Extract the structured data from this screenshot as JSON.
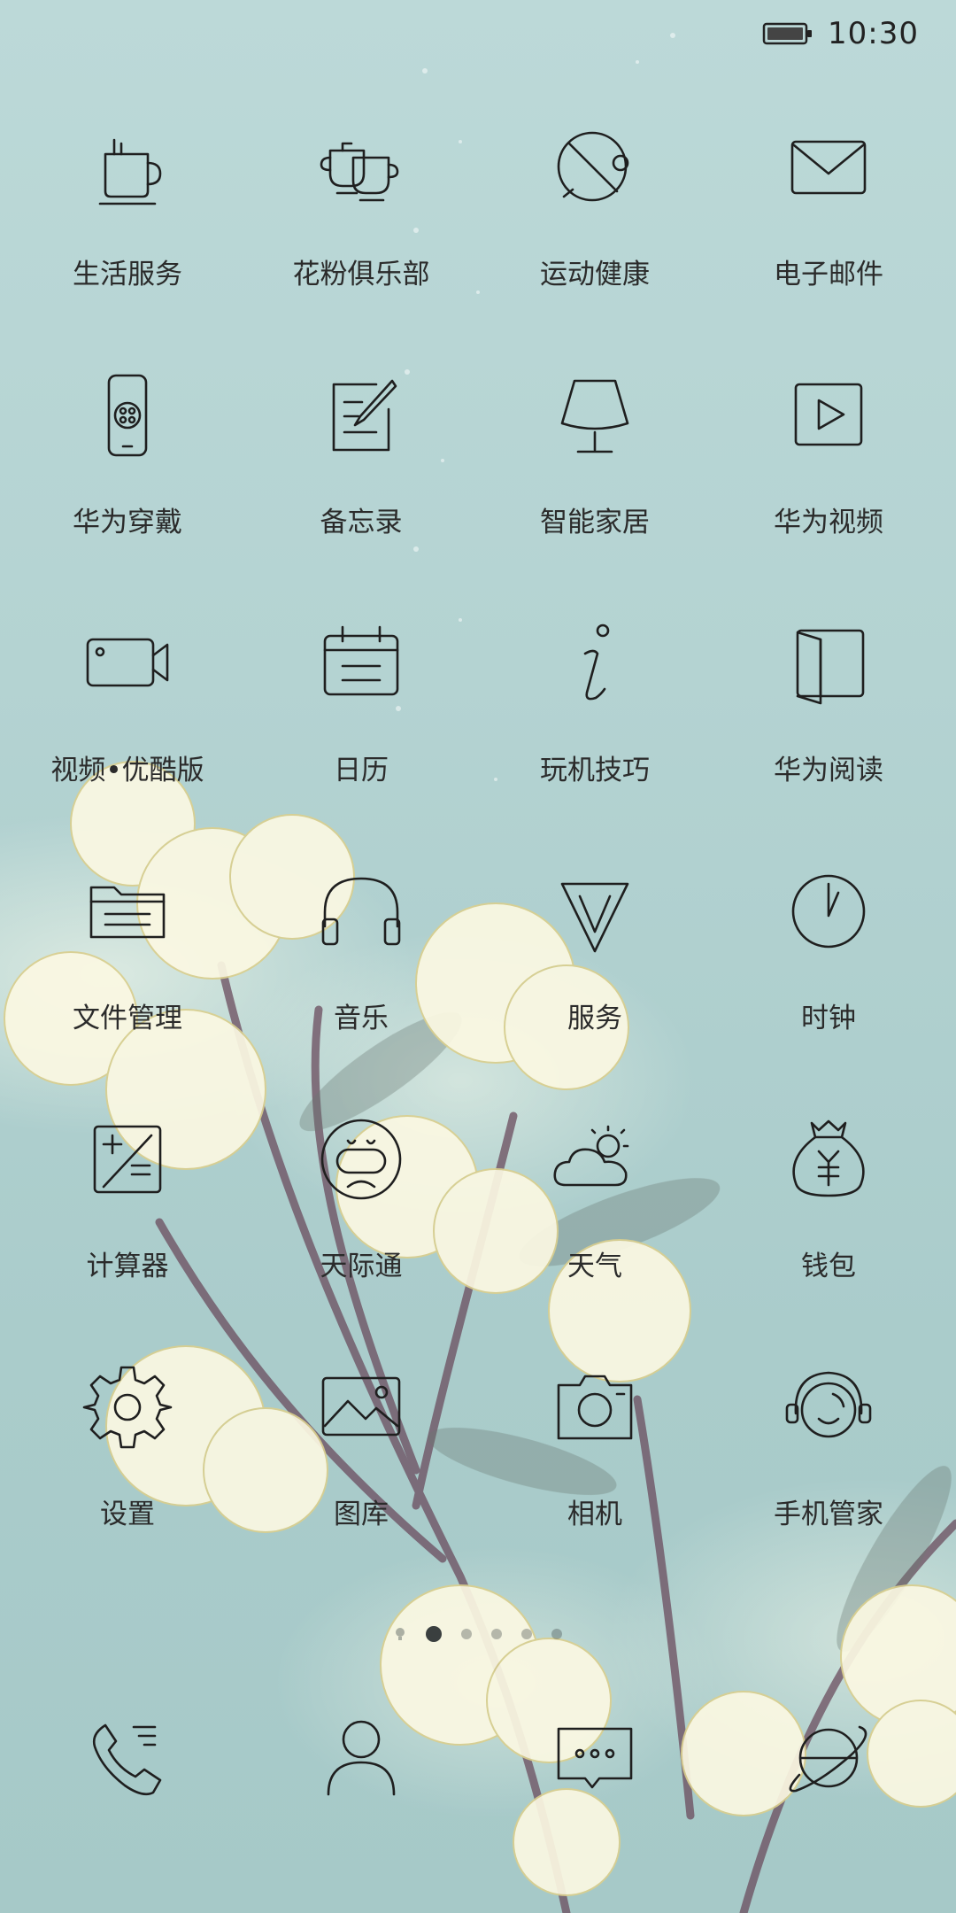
{
  "status_bar": {
    "time": "10:30",
    "battery_icon": "battery-icon"
  },
  "apps": [
    {
      "label": "生活服务",
      "icon": "cup-icon"
    },
    {
      "label": "花粉俱乐部",
      "icon": "cups-icon"
    },
    {
      "label": "运动健康",
      "icon": "runner-icon"
    },
    {
      "label": "电子邮件",
      "icon": "envelope-icon"
    },
    {
      "label": "华为穿戴",
      "icon": "wearable-icon"
    },
    {
      "label": "备忘录",
      "icon": "notepad-icon"
    },
    {
      "label": "智能家居",
      "icon": "lamp-icon"
    },
    {
      "label": "华为视频",
      "icon": "play-icon"
    },
    {
      "label": "视频•优酷版",
      "icon": "video-camera-icon"
    },
    {
      "label": "日历",
      "icon": "calendar-icon"
    },
    {
      "label": "玩机技巧",
      "icon": "info-icon"
    },
    {
      "label": "华为阅读",
      "icon": "book-icon"
    },
    {
      "label": "文件管理",
      "icon": "folder-icon"
    },
    {
      "label": "音乐",
      "icon": "headphones-icon"
    },
    {
      "label": "服务",
      "icon": "diamond-icon"
    },
    {
      "label": "时钟",
      "icon": "clock-icon"
    },
    {
      "label": "计算器",
      "icon": "calculator-icon"
    },
    {
      "label": "天际通",
      "icon": "face-icon"
    },
    {
      "label": "天气",
      "icon": "weather-icon"
    },
    {
      "label": "钱包",
      "icon": "wallet-icon"
    },
    {
      "label": "设置",
      "icon": "gear-icon"
    },
    {
      "label": "图库",
      "icon": "gallery-icon"
    },
    {
      "label": "相机",
      "icon": "camera-icon"
    },
    {
      "label": "手机管家",
      "icon": "phone-manager-icon"
    }
  ],
  "page_indicator": {
    "pages": 5,
    "active_index": 0
  },
  "dock": [
    {
      "icon": "phone-icon"
    },
    {
      "icon": "contacts-icon"
    },
    {
      "icon": "messages-icon"
    },
    {
      "icon": "browser-icon"
    }
  ]
}
